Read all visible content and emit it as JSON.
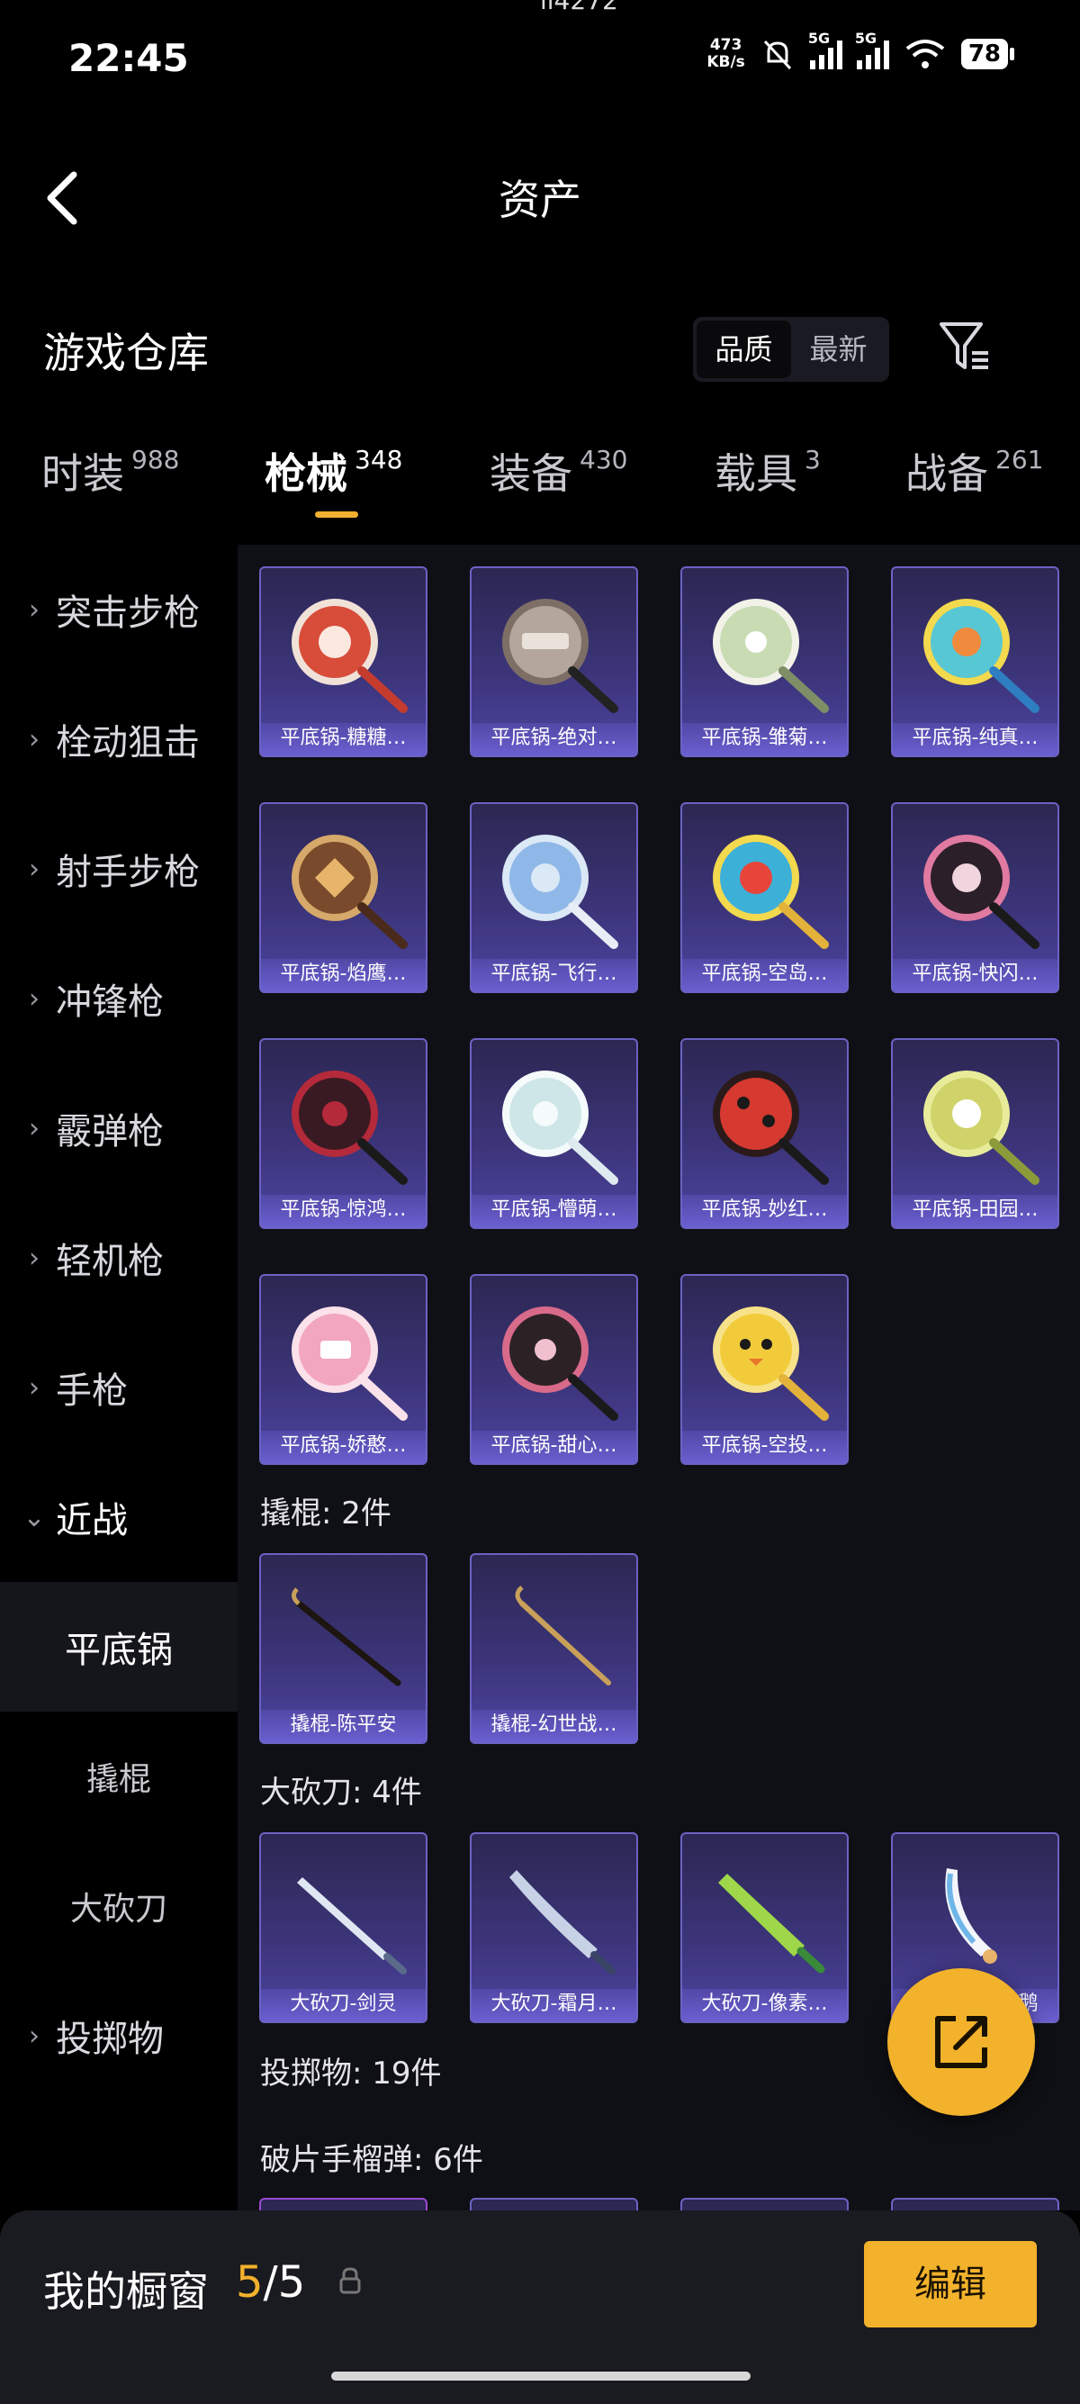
{
  "status": {
    "time": "22:45",
    "top_fragment": "ll4272",
    "speed_value": "473",
    "speed_unit": "KB/s",
    "signal1_tag": "5G",
    "signal2_tag": "5G",
    "battery": "78"
  },
  "header": {
    "title": "资产"
  },
  "warehouse": {
    "title": "游戏仓库",
    "sort_quality": "品质",
    "sort_latest": "最新"
  },
  "tabs": [
    {
      "name": "时装",
      "count": "988"
    },
    {
      "name": "枪械",
      "count": "348"
    },
    {
      "name": "装备",
      "count": "430"
    },
    {
      "name": "载具",
      "count": "3"
    },
    {
      "name": "战备",
      "count": "261"
    }
  ],
  "sidebar": {
    "items": [
      {
        "label": "突击步枪"
      },
      {
        "label": "栓动狙击"
      },
      {
        "label": "射手步枪"
      },
      {
        "label": "冲锋枪"
      },
      {
        "label": "霰弹枪"
      },
      {
        "label": "轻机枪"
      },
      {
        "label": "手枪"
      },
      {
        "label": "近战"
      }
    ],
    "subs": [
      {
        "label": "平底锅"
      },
      {
        "label": "撬棍"
      },
      {
        "label": "大砍刀"
      }
    ],
    "last": {
      "label": "投掷物"
    }
  },
  "items": {
    "pans": [
      "平底锅-糖糖…",
      "平底锅-绝对…",
      "平底锅-雏菊…",
      "平底锅-纯真…",
      "平底锅-焰鹰…",
      "平底锅-飞行…",
      "平底锅-空岛…",
      "平底锅-快闪…",
      "平底锅-惊鸿…",
      "平底锅-懵萌…",
      "平底锅-妙红…",
      "平底锅-田园…",
      "平底锅-娇憨…",
      "平底锅-甜心…",
      "平底锅-空投…"
    ],
    "crowbar_section": "撬棍: 2件",
    "crowbars": [
      "撬棍-陈平安",
      "撬棍-幻世战…"
    ],
    "machete_section": "大砍刀: 4件",
    "machetes": [
      "大砍刀-剑灵",
      "大砍刀-霜月…",
      "大砍刀-像素…",
      "大砍刀-云朵鹅"
    ],
    "throw_section": "投掷物: 19件",
    "frag_section": "破片手榴弹: 6件"
  },
  "showcase": {
    "label": "我的橱窗",
    "current": "5",
    "sep": "/",
    "total": "5",
    "edit": "编辑"
  }
}
